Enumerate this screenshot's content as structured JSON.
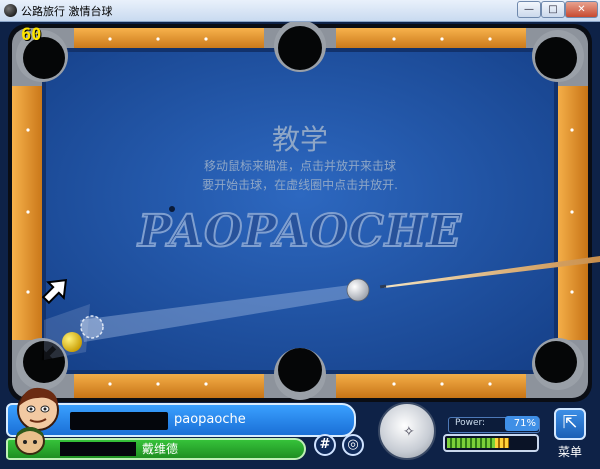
{
  "window": {
    "title": "公路旅行 激情台球",
    "minimize": "—",
    "maximize": "□",
    "close": "✕"
  },
  "hud": {
    "fps": "60",
    "tutorial_title": "教学",
    "tutorial_line1": "移动鼠标来瞄准，点击并放开来击球",
    "tutorial_line2": "要开始击球，在虚线圈中点击并放开.",
    "watermark": "PAOPAOCHE"
  },
  "player": {
    "name": "paopaoche"
  },
  "opponent": {
    "name": "戴维德"
  },
  "controls": {
    "grid_icon": "#",
    "target_icon": "◎",
    "spin_icon": "✧",
    "power_label": "Power:",
    "power_value": "71%",
    "power_level": 0.71,
    "menu_icon": "⇱",
    "menu_label": "菜单"
  },
  "colors": {
    "felt": "#1f57a8",
    "rail_wood": "#f0a23a",
    "player_bar": "#2f8cf0",
    "opponent_bar": "#2fb533",
    "fps": "#ffe400"
  }
}
